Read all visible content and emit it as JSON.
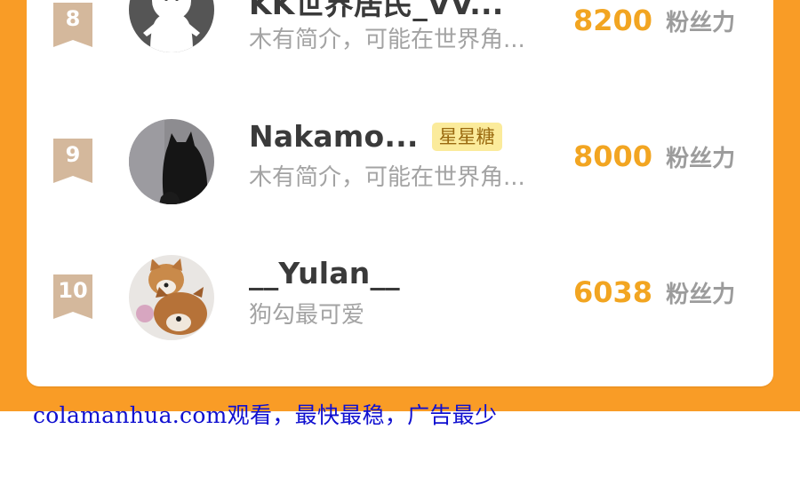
{
  "colors": {
    "frame": "#f99c26",
    "rank_badge": "#d4b89c",
    "fans_number": "#f2a521",
    "footer_text": "#1010d0"
  },
  "ranking": {
    "rows": [
      {
        "rank": "8",
        "name": "KK世界居民_VV...",
        "badge": "",
        "bio": "木有简介，可能在世界角...",
        "fans": "8200",
        "fans_label": "粉丝力",
        "avatar_icon": "white-ghost-character-avatar"
      },
      {
        "rank": "9",
        "name": "Nakamo...",
        "badge": "星星糖",
        "bio": "木有简介，可能在世界角...",
        "fans": "8000",
        "fans_label": "粉丝力",
        "avatar_icon": "black-cat-silhouette-avatar"
      },
      {
        "rank": "10",
        "name": "__Yulan__",
        "badge": "",
        "bio": "狗勾最可爱",
        "fans": "6038",
        "fans_label": "粉丝力",
        "avatar_icon": "shiba-dogs-avatar"
      }
    ]
  },
  "footer": {
    "text": "colamanhua.com观看，最快最稳，广告最少"
  }
}
